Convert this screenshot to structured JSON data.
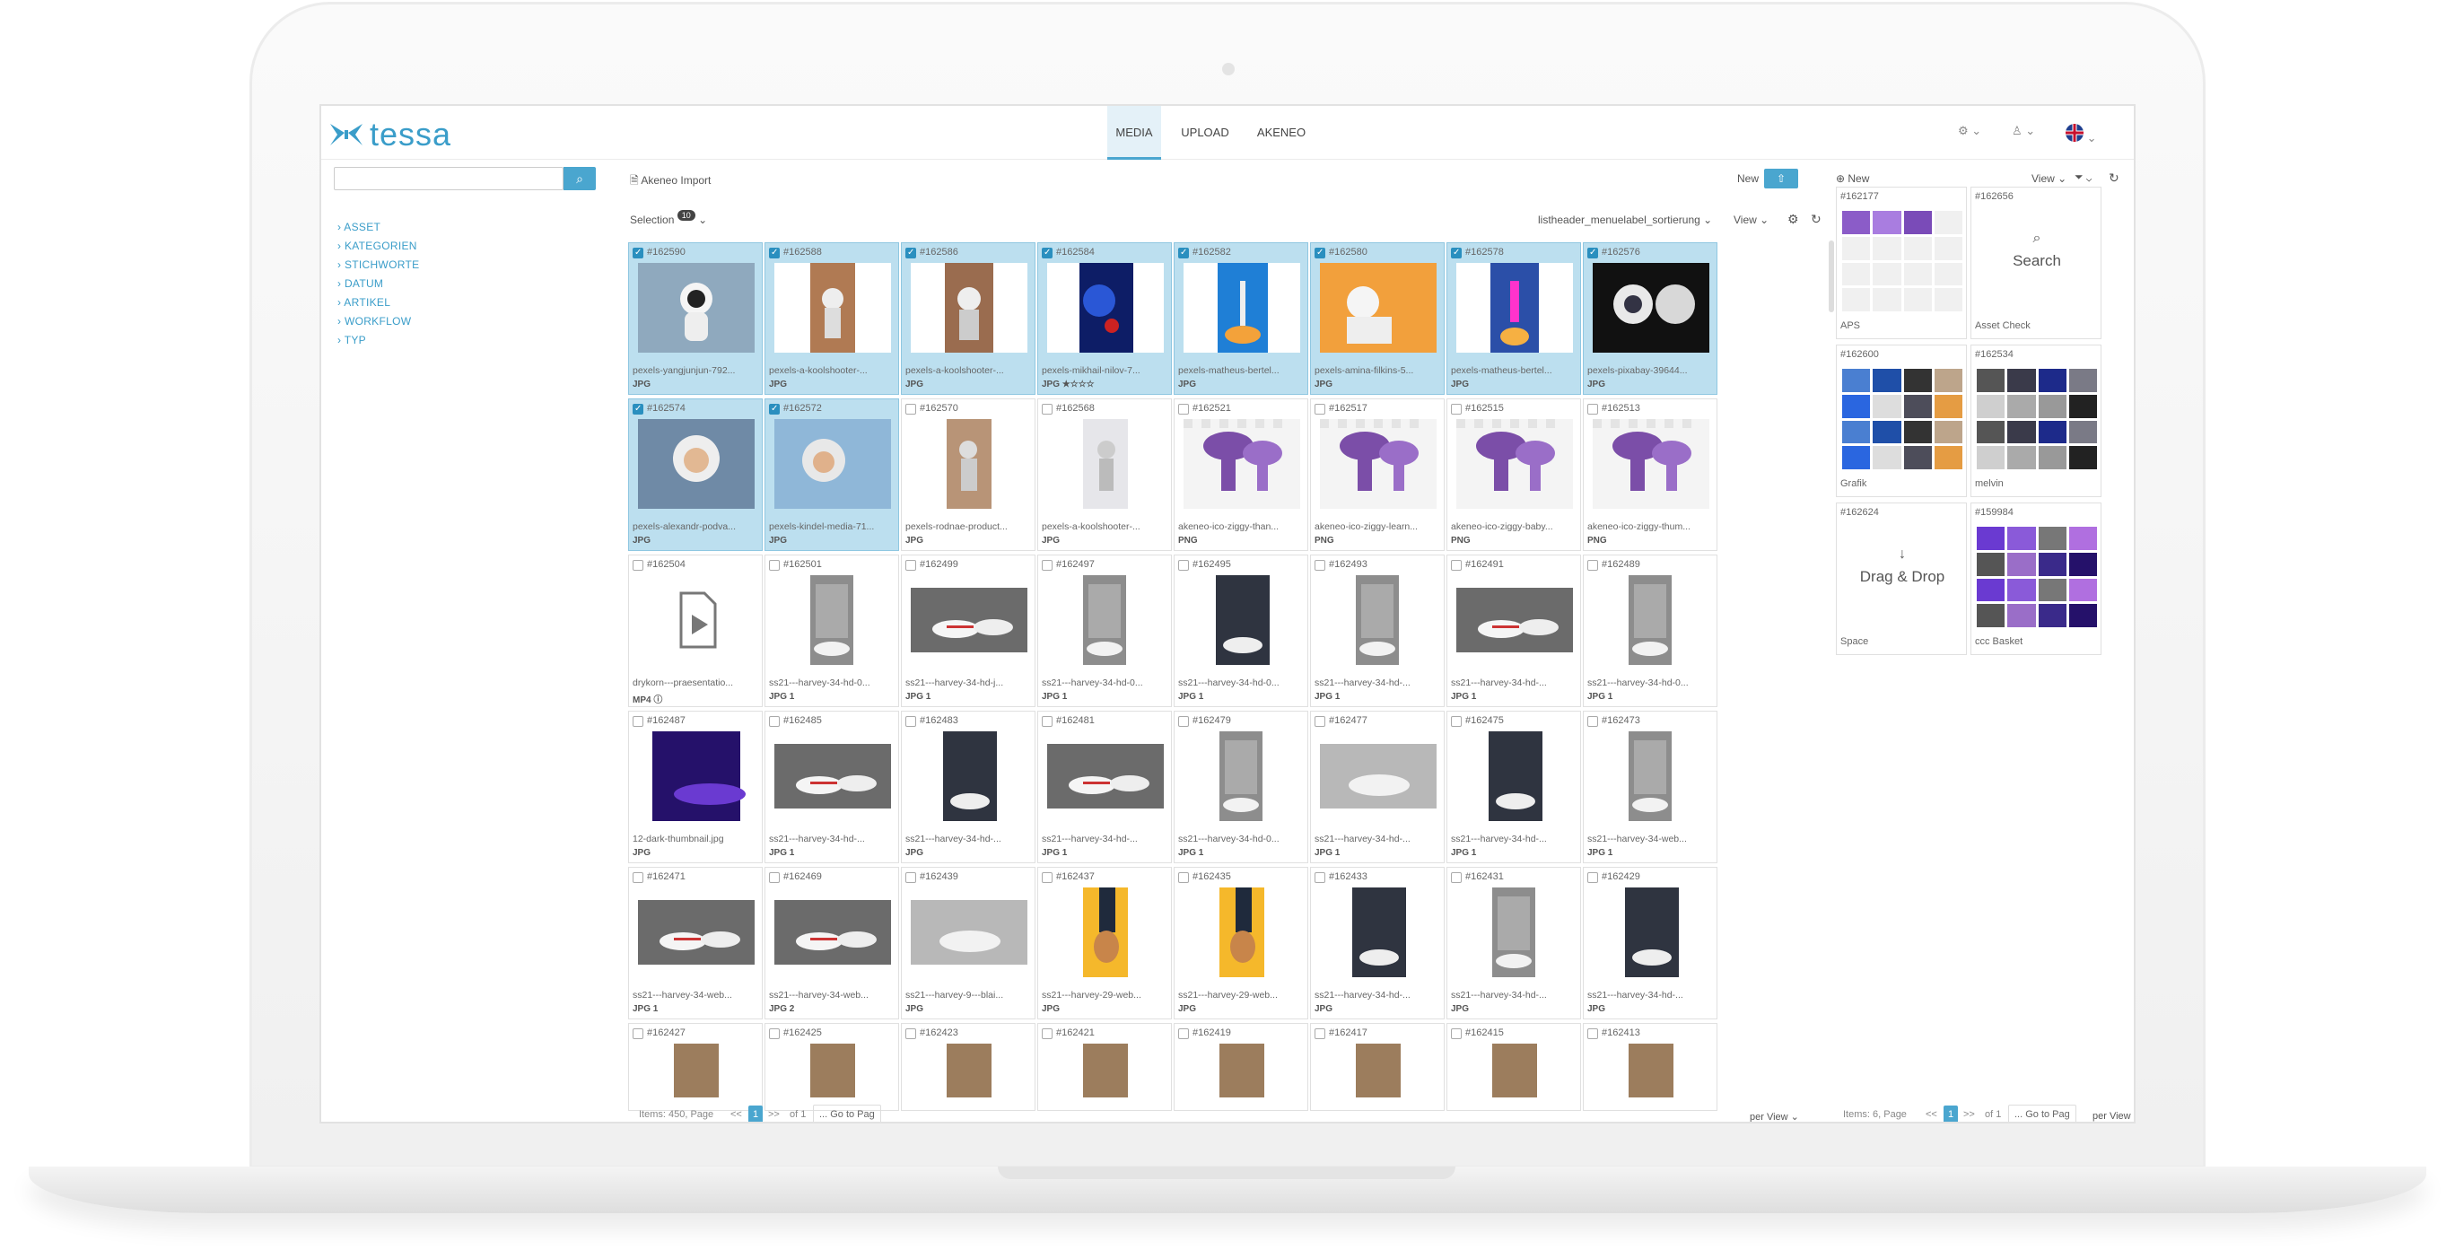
{
  "app": {
    "logo": "tessa"
  },
  "nav": {
    "tabs": [
      {
        "label": "MEDIA",
        "active": true
      },
      {
        "label": "UPLOAD",
        "active": false
      },
      {
        "label": "AKENEO",
        "active": false
      }
    ]
  },
  "header_icons": {
    "settings": "gear-icon",
    "user": "user-icon",
    "language": "uk-flag-icon"
  },
  "sidebar": {
    "search_placeholder": "",
    "tree": [
      "ASSET",
      "KATEGORIEN",
      "STICHWORTE",
      "DATUM",
      "ARTIKEL",
      "WORKFLOW",
      "TYP"
    ]
  },
  "media": {
    "import_label": "Akeneo Import",
    "new_label": "New",
    "selection_label": "Selection",
    "selection_count": "10",
    "sort_label": "listheader_menuelabel_sortierung",
    "view_label": "View",
    "tiles": [
      {
        "id": "#162590",
        "name": "pexels-yangjunjun-792...",
        "type": "JPG",
        "sel": true,
        "kind": "astro"
      },
      {
        "id": "#162588",
        "name": "pexels-a-koolshooter-...",
        "type": "JPG",
        "sel": true,
        "kind": "astro2"
      },
      {
        "id": "#162586",
        "name": "pexels-a-koolshooter-...",
        "type": "JPG",
        "sel": true,
        "kind": "astro3"
      },
      {
        "id": "#162584",
        "name": "pexels-mikhail-nilov-7...",
        "type": "JPG ★☆☆☆",
        "sel": true,
        "kind": "blue"
      },
      {
        "id": "#162582",
        "name": "pexels-matheus-bertel...",
        "type": "JPG",
        "sel": true,
        "kind": "rocket"
      },
      {
        "id": "#162580",
        "name": "pexels-amina-filkins-5...",
        "type": "JPG",
        "sel": true,
        "kind": "orange"
      },
      {
        "id": "#162578",
        "name": "pexels-matheus-bertel...",
        "type": "JPG",
        "sel": true,
        "kind": "rocket2"
      },
      {
        "id": "#162576",
        "name": "pexels-pixabay-39644...",
        "type": "JPG",
        "sel": true,
        "kind": "astro4"
      },
      {
        "id": "#162574",
        "name": "pexels-alexandr-podva...",
        "type": "JPG",
        "sel": true,
        "kind": "kid"
      },
      {
        "id": "#162572",
        "name": "pexels-kindel-media-71...",
        "type": "JPG",
        "sel": true,
        "kind": "kid2"
      },
      {
        "id": "#162570",
        "name": "pexels-rodnae-product...",
        "type": "JPG",
        "sel": false,
        "kind": "astro5"
      },
      {
        "id": "#162568",
        "name": "pexels-a-koolshooter-...",
        "type": "JPG",
        "sel": false,
        "kind": "astro6"
      },
      {
        "id": "#162521",
        "name": "akeneo-ico-ziggy-than...",
        "type": "PNG",
        "sel": false,
        "kind": "ziggy"
      },
      {
        "id": "#162517",
        "name": "akeneo-ico-ziggy-learn...",
        "type": "PNG",
        "sel": false,
        "kind": "ziggy"
      },
      {
        "id": "#162515",
        "name": "akeneo-ico-ziggy-baby...",
        "type": "PNG",
        "sel": false,
        "kind": "ziggy"
      },
      {
        "id": "#162513",
        "name": "akeneo-ico-ziggy-thum...",
        "type": "PNG",
        "sel": false,
        "kind": "ziggy"
      },
      {
        "id": "#162504",
        "name": "drykorn---praesentatio...",
        "type": "MP4 ⓘ",
        "sel": false,
        "kind": "video"
      },
      {
        "id": "#162501",
        "name": "ss21---harvey-34-hd-0...",
        "type": "JPG 1",
        "sel": false,
        "kind": "shoe"
      },
      {
        "id": "#162499",
        "name": "ss21---harvey-34-hd-j...",
        "type": "JPG 1",
        "sel": false,
        "kind": "shoe2"
      },
      {
        "id": "#162497",
        "name": "ss21---harvey-34-hd-0...",
        "type": "JPG 1",
        "sel": false,
        "kind": "shoe"
      },
      {
        "id": "#162495",
        "name": "ss21---harvey-34-hd-0...",
        "type": "JPG 1",
        "sel": false,
        "kind": "shoe3"
      },
      {
        "id": "#162493",
        "name": "ss21---harvey-34-hd-...",
        "type": "JPG 1",
        "sel": false,
        "kind": "shoe"
      },
      {
        "id": "#162491",
        "name": "ss21---harvey-34-hd-...",
        "type": "JPG 1",
        "sel": false,
        "kind": "shoe2"
      },
      {
        "id": "#162489",
        "name": "ss21---harvey-34-hd-0...",
        "type": "JPG 1",
        "sel": false,
        "kind": "shoe"
      },
      {
        "id": "#162487",
        "name": "12-dark-thumbnail.jpg",
        "type": "JPG",
        "sel": false,
        "kind": "dark"
      },
      {
        "id": "#162485",
        "name": "ss21---harvey-34-hd-...",
        "type": "JPG 1",
        "sel": false,
        "kind": "shoe2"
      },
      {
        "id": "#162483",
        "name": "ss21---harvey-34-hd-...",
        "type": "JPG",
        "sel": false,
        "kind": "shoe3"
      },
      {
        "id": "#162481",
        "name": "ss21---harvey-34-hd-...",
        "type": "JPG 1",
        "sel": false,
        "kind": "shoe2"
      },
      {
        "id": "#162479",
        "name": "ss21---harvey-34-hd-0...",
        "type": "JPG 1",
        "sel": false,
        "kind": "shoe"
      },
      {
        "id": "#162477",
        "name": "ss21---harvey-34-hd-...",
        "type": "JPG 1",
        "sel": false,
        "kind": "shoe4"
      },
      {
        "id": "#162475",
        "name": "ss21---harvey-34-hd-...",
        "type": "JPG 1",
        "sel": false,
        "kind": "shoe3"
      },
      {
        "id": "#162473",
        "name": "ss21---harvey-34-web...",
        "type": "JPG 1",
        "sel": false,
        "kind": "shoe"
      },
      {
        "id": "#162471",
        "name": "ss21---harvey-34-web...",
        "type": "JPG 1",
        "sel": false,
        "kind": "shoe2"
      },
      {
        "id": "#162469",
        "name": "ss21---harvey-34-web...",
        "type": "JPG 2",
        "sel": false,
        "kind": "shoe2"
      },
      {
        "id": "#162439",
        "name": "ss21---harvey-9---blai...",
        "type": "JPG",
        "sel": false,
        "kind": "shoe4"
      },
      {
        "id": "#162437",
        "name": "ss21---harvey-29-web...",
        "type": "JPG",
        "sel": false,
        "kind": "yellow"
      },
      {
        "id": "#162435",
        "name": "ss21---harvey-29-web...",
        "type": "JPG",
        "sel": false,
        "kind": "yellow"
      },
      {
        "id": "#162433",
        "name": "ss21---harvey-34-hd-...",
        "type": "JPG",
        "sel": false,
        "kind": "shoe3"
      },
      {
        "id": "#162431",
        "name": "ss21---harvey-34-hd-...",
        "type": "JPG",
        "sel": false,
        "kind": "shoe"
      },
      {
        "id": "#162429",
        "name": "ss21---harvey-34-hd-...",
        "type": "JPG",
        "sel": false,
        "kind": "shoe3"
      },
      {
        "id": "#162427",
        "name": "",
        "type": "",
        "sel": false,
        "kind": "brown"
      },
      {
        "id": "#162425",
        "name": "",
        "type": "",
        "sel": false,
        "kind": "brown"
      },
      {
        "id": "#162423",
        "name": "",
        "type": "",
        "sel": false,
        "kind": "brown"
      },
      {
        "id": "#162421",
        "name": "",
        "type": "",
        "sel": false,
        "kind": "brown"
      },
      {
        "id": "#162419",
        "name": "",
        "type": "",
        "sel": false,
        "kind": "brown"
      },
      {
        "id": "#162417",
        "name": "",
        "type": "",
        "sel": false,
        "kind": "brown"
      },
      {
        "id": "#162415",
        "name": "",
        "type": "",
        "sel": false,
        "kind": "brown"
      },
      {
        "id": "#162413",
        "name": "",
        "type": "",
        "sel": false,
        "kind": "brown"
      }
    ],
    "pager": {
      "items": "Items: 450, Page",
      "prev": "<<",
      "page": "1",
      "next": ">>",
      "of": "of 1",
      "goto": "... Go to Pag",
      "per_view": "per View"
    }
  },
  "right": {
    "new_label": "New",
    "view_label": "View",
    "baskets": [
      {
        "id": "#162177",
        "name": "APS",
        "kind": "grid-purple"
      },
      {
        "id": "#162656",
        "name": "Asset Check",
        "kind": "search",
        "center": "Search"
      },
      {
        "id": "#162600",
        "name": "Grafik",
        "kind": "grid-mix"
      },
      {
        "id": "#162534",
        "name": "melvin",
        "kind": "grid-mix2"
      },
      {
        "id": "#162624",
        "name": "Space",
        "kind": "drop",
        "center": "Drag & Drop"
      },
      {
        "id": "#159984",
        "name": "ccc Basket",
        "kind": "grid-purple2"
      }
    ],
    "pager": {
      "items": "Items: 6, Page",
      "prev": "<<",
      "page": "1",
      "next": ">>",
      "of": "of 1",
      "goto": "... Go to Pag",
      "per_view": "per View"
    }
  },
  "colors": {
    "accent": "#4aa6cf",
    "selected": "#bcdfef"
  }
}
